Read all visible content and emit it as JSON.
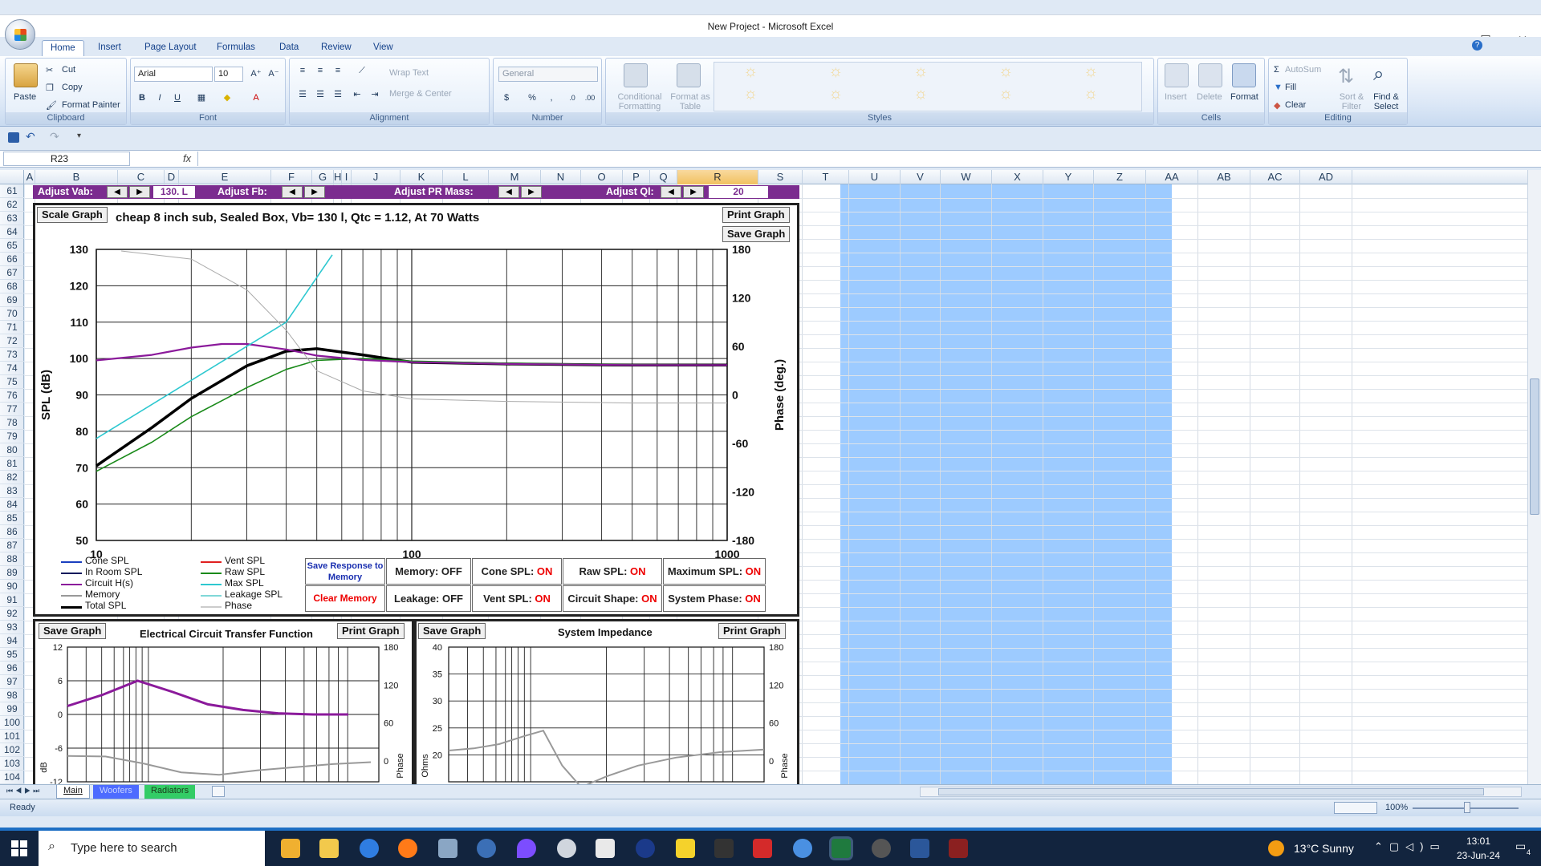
{
  "window": {
    "title": "New Project - Microsoft Excel",
    "minimize": "—",
    "maximize": "☐",
    "close": "✕"
  },
  "tabs": [
    "Home",
    "Insert",
    "Page Layout",
    "Formulas",
    "Data",
    "Review",
    "View"
  ],
  "ribbon": {
    "clipboard": {
      "paste": "Paste",
      "cut": "Cut",
      "copy": "Copy",
      "format_painter": "Format Painter",
      "label": "Clipboard"
    },
    "font": {
      "name": "Arial",
      "size": "10",
      "label": "Font",
      "bold": "B",
      "italic": "I",
      "underline": "U"
    },
    "alignment": {
      "wrap": "Wrap Text",
      "merge": "Merge & Center",
      "label": "Alignment"
    },
    "number": {
      "format": "General",
      "label": "Number",
      "currency": "$",
      "percent": "%",
      "comma": ","
    },
    "styles": {
      "cond": "Conditional Formatting",
      "table": "Format as Table",
      "label": "Styles"
    },
    "cells": {
      "insert": "Insert",
      "delete": "Delete",
      "format": "Format",
      "label": "Cells"
    },
    "editing": {
      "autosum": "AutoSum",
      "fill": "Fill",
      "clear": "Clear",
      "sort": "Sort & Filter",
      "find": "Find & Select",
      "label": "Editing"
    }
  },
  "namebox": "R23",
  "fx": "fx",
  "columns": [
    "A",
    "B",
    "C",
    "D",
    "E",
    "F",
    "G",
    "H",
    "I",
    "J",
    "K",
    "L",
    "M",
    "N",
    "O",
    "P",
    "Q",
    "R",
    "S",
    "T",
    "U",
    "V",
    "W",
    "X",
    "Y",
    "Z",
    "AA",
    "AB",
    "AC",
    "AD"
  ],
  "rows": [
    "61",
    "62",
    "63",
    "64",
    "65",
    "66",
    "67",
    "68",
    "69",
    "70",
    "71",
    "72",
    "73",
    "74",
    "75",
    "76",
    "77",
    "78",
    "79",
    "80",
    "81",
    "82",
    "83",
    "84",
    "85",
    "86",
    "87",
    "88",
    "89",
    "90",
    "91",
    "92",
    "93",
    "94",
    "95",
    "96",
    "97",
    "98",
    "99",
    "100",
    "101",
    "102",
    "103",
    "104"
  ],
  "controls": {
    "vab_label": "Adjust Vab:",
    "vab_value": "130. L",
    "fb_label": "Adjust Fb:",
    "pr_label": "Adjust PR Mass:",
    "ql_label": "Adjust Ql:",
    "ql_value": "20"
  },
  "main_chart": {
    "scale_btn": "Scale Graph",
    "print_btn": "Print Graph",
    "save_btn": "Save Graph",
    "title": "cheap 8 inch sub,  Sealed Box, Vb= 130 l,  Qtc = 1.12,  At 70 Watts",
    "ylabel": "SPL (dB)",
    "y2label": "Phase (deg.)",
    "yticks": [
      "130",
      "120",
      "110",
      "100",
      "90",
      "80",
      "70",
      "60",
      "50"
    ],
    "y2ticks": [
      "180",
      "120",
      "60",
      "0",
      "-60",
      "-120",
      "-180"
    ],
    "xticks": [
      "10",
      "100",
      "1000"
    ]
  },
  "chart_data": [
    {
      "type": "line",
      "title": "cheap 8 inch sub,  Sealed Box, Vb= 130 l,  Qtc = 1.12,  At 70 Watts",
      "xlabel": "",
      "ylabel": "SPL (dB)",
      "y2label": "Phase (deg.)",
      "xscale": "log",
      "xlim": [
        10,
        1000
      ],
      "ylim": [
        50,
        130
      ],
      "y2lim": [
        -180,
        180
      ],
      "grid": true,
      "series": [
        {
          "name": "Total SPL",
          "color": "#000000",
          "x": [
            10,
            15,
            20,
            30,
            40,
            50,
            70,
            100,
            200,
            500,
            1000
          ],
          "y": [
            70.5,
            81,
            89,
            98,
            102,
            102.7,
            101,
            99,
            98.5,
            98.2,
            98.2
          ]
        },
        {
          "name": "Raw SPL",
          "color": "#1a8a1a",
          "x": [
            10,
            15,
            20,
            30,
            40,
            50,
            70,
            100,
            200,
            500,
            1000
          ],
          "y": [
            69,
            77,
            84,
            92,
            97,
            99.5,
            100,
            99.3,
            98.7,
            98.3,
            98.2
          ]
        },
        {
          "name": "Circuit H(s)",
          "color": "#8b1a9b",
          "x": [
            10,
            15,
            20,
            25,
            30,
            40,
            50,
            70,
            100,
            200,
            500,
            1000
          ],
          "y": [
            99.5,
            101,
            103,
            104,
            104,
            102.5,
            100.8,
            99.6,
            99,
            98.5,
            98.2,
            98.2
          ]
        },
        {
          "name": "Max SPL",
          "color": "#2ec8d0",
          "x": [
            10,
            20,
            40,
            56
          ],
          "y": [
            78,
            94,
            110,
            128.5
          ]
        },
        {
          "name": "Phase",
          "color": "#aaaaaa",
          "x": [
            12,
            20,
            30,
            40,
            50,
            70,
            100,
            200,
            500,
            1000
          ],
          "y2": [
            178,
            168,
            130,
            80,
            30,
            5,
            -5,
            -8,
            -10,
            -10
          ]
        }
      ]
    },
    {
      "type": "line",
      "title": "Electrical Circuit Transfer Function",
      "ylabel": "dB",
      "y2label": "Phase",
      "ylim": [
        -12,
        12
      ],
      "y2lim": [
        0,
        180
      ],
      "yticks": [
        "12",
        "6",
        "0",
        "-6",
        "-12"
      ],
      "y2ticks": [
        "180",
        "120",
        "60",
        "0"
      ],
      "series": [
        {
          "name": "dB",
          "color": "#8b1a9b",
          "y": [
            1.5,
            3.5,
            6,
            4,
            1.8,
            0.8,
            0.2,
            0,
            0
          ]
        },
        {
          "name": "Phase",
          "color": "#999999",
          "y2": [
            8,
            7,
            -4,
            -18,
            -22,
            -15,
            -10,
            -5,
            -2
          ]
        }
      ]
    },
    {
      "type": "line",
      "title": "System Impedance",
      "ylabel": "Ohms",
      "y2label": "Phase",
      "ylim": [
        15,
        40
      ],
      "y2lim": [
        0,
        180
      ],
      "yticks": [
        "40",
        "35",
        "30",
        "25",
        "20"
      ],
      "y2ticks": [
        "180",
        "120",
        "60",
        "0"
      ],
      "series": [
        {
          "name": "Impedance",
          "color": "#999999",
          "y": [
            20.8,
            21.2,
            22,
            23.5,
            24.5,
            18,
            14,
            16,
            18,
            19.5,
            20.5,
            21
          ]
        }
      ]
    }
  ],
  "legend": {
    "col1": [
      "Cone SPL",
      "In Room SPL",
      "Circuit H(s)",
      "Memory",
      "Total SPL"
    ],
    "col2": [
      "Vent SPL",
      "Raw SPL",
      "Max SPL",
      "Leakage SPL",
      "Phase"
    ],
    "col1_colors": [
      "#1a3fbf",
      "#0a1a5c",
      "#8b1a9b",
      "#999999",
      "#000000"
    ],
    "col2_colors": [
      "#e02020",
      "#1a8a1a",
      "#2ec8d0",
      "#80d8d8",
      "#cccccc"
    ]
  },
  "toggles": {
    "save_resp": "Save Response to Memory",
    "clear_mem": "Clear Memory",
    "memory": "Memory: OFF",
    "leakage": "Leakage: OFF",
    "cone_spl": "Cone SPL: ",
    "vent_spl": "Vent SPL: ",
    "raw_spl": "Raw SPL: ",
    "circuit_shape": "Circuit Shape: ",
    "max_spl": "Maximum SPL: ",
    "system_phase": "System Phase: ",
    "on": "ON"
  },
  "sub1": {
    "save": "Save Graph",
    "title": "Electrical Circuit Transfer Function",
    "print": "Print Graph",
    "ylabel": "dB",
    "y2label": "Phase"
  },
  "sub2": {
    "save": "Save Graph",
    "title": "System Impedance",
    "print": "Print Graph",
    "ylabel": "Ohms",
    "y2label": "Phase"
  },
  "sheets": [
    "Main",
    "Woofers",
    "Radiators"
  ],
  "status": {
    "ready": "Ready",
    "zoom": "100%"
  },
  "taskbar": {
    "search": "Type here to search",
    "weather": "13°C  Sunny",
    "time": "13:01",
    "date": "23-Jun-24",
    "notif": "4"
  }
}
